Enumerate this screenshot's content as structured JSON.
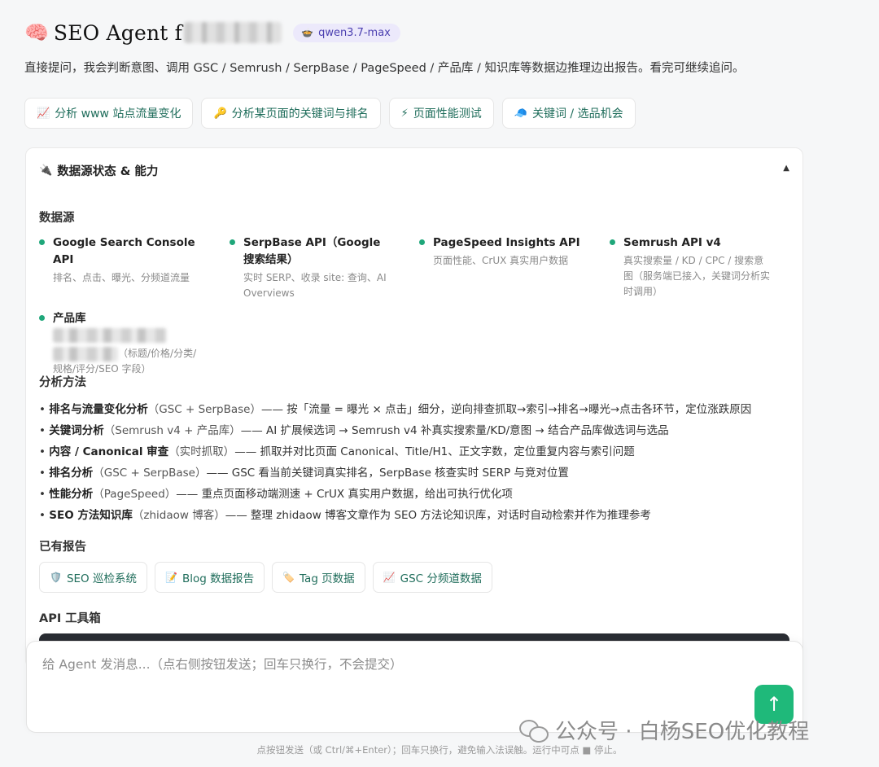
{
  "header": {
    "title_icon": "brain-icon",
    "title_icon_glyph": "🧠",
    "title": "SEO Agent f",
    "model_icon_glyph": "🍲",
    "model": "qwen3.7-max"
  },
  "subtitle": "直接提问，我会判断意图、调用 GSC / Semrush / SerpBase / PageSpeed / 产品库 / 知识库等数据边推理边出报告。看完可继续追问。",
  "quick_actions": [
    {
      "icon": "chart-icon",
      "glyph": "📈",
      "label": "分析 www 站点流量变化"
    },
    {
      "icon": "key-icon",
      "glyph": "🔑",
      "label": "分析某页面的关键词与排名"
    },
    {
      "icon": "lightning-icon",
      "glyph": "⚡",
      "label": "页面性能测试"
    },
    {
      "icon": "cap-icon",
      "glyph": "🧢",
      "label": "关键词 / 选品机会"
    }
  ],
  "panel": {
    "icon_glyph": "🔌",
    "title": "数据源状态 & 能力",
    "caret": "▲",
    "sources_heading": "数据源",
    "sources": [
      {
        "name": "Google Search Console API",
        "desc": "排名、点击、曝光、分频道流量"
      },
      {
        "name": "SerpBase API（Google 搜索结果）",
        "desc": "实时 SERP、收录 site: 查询、AI Overviews"
      },
      {
        "name": "PageSpeed Insights API",
        "desc": "页面性能、CrUX 真实用户数据"
      },
      {
        "name": "Semrush API v4",
        "desc": "真实搜索量 / KD / CPC / 搜索意图（服务端已接入，关键词分析实时调用）"
      },
      {
        "name": "产品库",
        "desc": "（标题/价格/分类/规格/评分/SEO 字段）"
      }
    ],
    "methods_heading": "分析方法",
    "methods": [
      {
        "name": "排名与流量变化分析",
        "paren": "（GSC + SerpBase）",
        "text": "—— 按「流量 = 曝光 × 点击」细分，逆向排查抓取→索引→排名→曝光→点击各环节，定位涨跌原因"
      },
      {
        "name": "关键词分析",
        "paren": "（Semrush v4 + 产品库）",
        "text": "—— AI 扩展候选词 → Semrush v4 补真实搜索量/KD/意图 → 结合产品库做选词与选品"
      },
      {
        "name": "内容 / Canonical 审查",
        "paren": "（实时抓取）",
        "text": "—— 抓取并对比页面 Canonical、Title/H1、正文字数，定位重复内容与索引问题"
      },
      {
        "name": "排名分析",
        "paren": "（GSC + SerpBase）",
        "text": "—— GSC 看当前关键词真实排名，SerpBase 核查实时 SERP 与竞对位置"
      },
      {
        "name": "性能分析",
        "paren": "（PageSpeed）",
        "text": "—— 重点页面移动端测速 + CrUX 真实用户数据，给出可执行优化项"
      },
      {
        "name": "SEO 方法知识库",
        "paren": "（zhidaow 博客）",
        "text": "—— 整理 zhidaow 博客文章作为 SEO 方法论知识库，对话时自动检索并作为推理参考"
      }
    ],
    "reports_heading": "已有报告",
    "reports": [
      {
        "icon": "shield-icon",
        "glyph": "🛡️",
        "label": "SEO 巡检系统"
      },
      {
        "icon": "memo-icon",
        "glyph": "📝",
        "label": "Blog 数据报告"
      },
      {
        "icon": "tag-icon",
        "glyph": "🏷️",
        "label": "Tag 页数据"
      },
      {
        "icon": "chart-icon",
        "glyph": "📈",
        "label": "GSC 分频道数据"
      }
    ],
    "api_heading": "API 工具箱"
  },
  "composer": {
    "placeholder": "给 Agent 发消息...（点右侧按钮发送；回车只换行，不会提交）",
    "send_glyph": "↑"
  },
  "hint": "点按钮发送（或 Ctrl/⌘+Enter）；回车只换行，避免输入法误触。运行中可点 ■ 停止。",
  "watermark": "公众号 · 白杨SEO优化教程"
}
